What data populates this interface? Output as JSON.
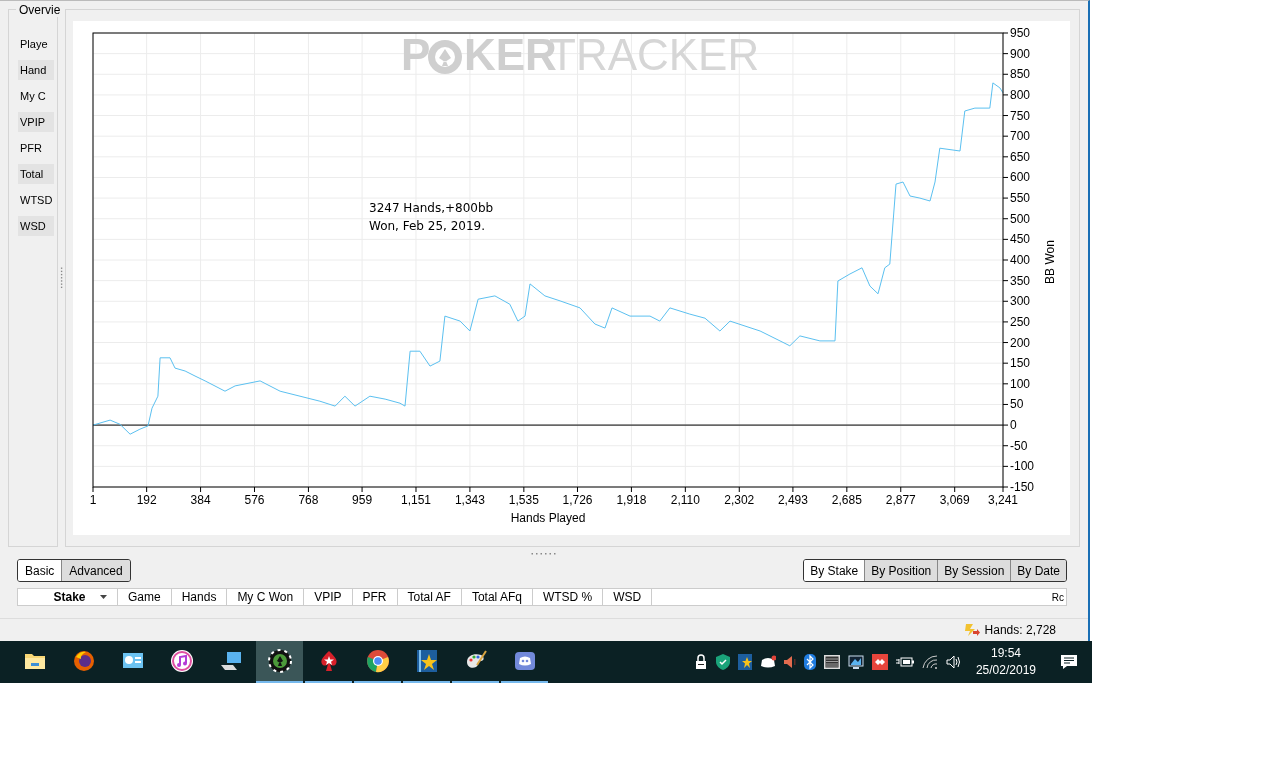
{
  "overview": {
    "title": "Overvie",
    "items": [
      {
        "label": "Playe"
      },
      {
        "label": "Hand"
      },
      {
        "label": "My C"
      },
      {
        "label": "VPIP"
      },
      {
        "label": "PFR"
      },
      {
        "label": "Total"
      },
      {
        "label": "WTSD"
      },
      {
        "label": "WSD"
      }
    ]
  },
  "chart": {
    "logo": [
      "P",
      "KER",
      "TRACKER"
    ],
    "chart_data": {
      "type": "line",
      "xlabel": "Hands Played",
      "ylabel": "BB Won",
      "xlim": [
        1,
        3241
      ],
      "ylim": [
        -150,
        950
      ],
      "xticks": [
        {
          "value": 1,
          "label": "1"
        },
        {
          "value": 192,
          "label": "192"
        },
        {
          "value": 384,
          "label": "384"
        },
        {
          "value": 576,
          "label": "576"
        },
        {
          "value": 768,
          "label": "768"
        },
        {
          "value": 959,
          "label": "959"
        },
        {
          "value": 1151,
          "label": "1,151"
        },
        {
          "value": 1343,
          "label": "1,343"
        },
        {
          "value": 1535,
          "label": "1,535"
        },
        {
          "value": 1726,
          "label": "1,726"
        },
        {
          "value": 1918,
          "label": "1,918"
        },
        {
          "value": 2110,
          "label": "2,110"
        },
        {
          "value": 2302,
          "label": "2,302"
        },
        {
          "value": 2493,
          "label": "2,493"
        },
        {
          "value": 2685,
          "label": "2,685"
        },
        {
          "value": 2877,
          "label": "2,877"
        },
        {
          "value": 3069,
          "label": "3,069"
        },
        {
          "value": 3241,
          "label": "3,241"
        }
      ],
      "yticks": [
        -150,
        -100,
        -50,
        0,
        50,
        100,
        150,
        200,
        250,
        300,
        350,
        400,
        450,
        500,
        550,
        600,
        650,
        700,
        750,
        800,
        850,
        900,
        950
      ],
      "x": [
        1,
        62,
        97,
        133,
        168,
        197,
        211,
        232,
        240,
        275,
        293,
        329,
        364,
        400,
        471,
        507,
        596,
        667,
        738,
        809,
        863,
        898,
        934,
        987,
        1041,
        1094,
        1112,
        1130,
        1165,
        1201,
        1236,
        1254,
        1308,
        1343,
        1372,
        1432,
        1485,
        1514,
        1539,
        1557,
        1610,
        1664,
        1735,
        1788,
        1824,
        1849,
        1913,
        1984,
        2019,
        2055,
        2126,
        2180,
        2233,
        2269,
        2376,
        2447,
        2482,
        2518,
        2589,
        2643,
        2653,
        2696,
        2739,
        2767,
        2796,
        2820,
        2838,
        2860,
        2885,
        2910,
        2945,
        2981,
        2999,
        3016,
        3088,
        3105,
        3141,
        3194,
        3205,
        3230,
        3241
      ],
      "series": [
        {
          "color": "#5bc0f0",
          "values": [
            0,
            12,
            2,
            -22,
            -10,
            -2,
            41,
            70,
            163,
            163,
            138,
            131,
            119,
            107,
            82,
            95,
            107,
            82,
            70,
            58,
            46,
            70,
            46,
            70,
            63,
            53,
            46,
            179,
            179,
            143,
            155,
            264,
            252,
            228,
            305,
            313,
            293,
            252,
            264,
            342,
            313,
            301,
            284,
            245,
            235,
            284,
            264,
            264,
            252,
            284,
            269,
            259,
            228,
            252,
            228,
            204,
            192,
            216,
            204,
            204,
            349,
            366,
            381,
            337,
            318,
            381,
            390,
            584,
            589,
            555,
            550,
            543,
            589,
            671,
            664,
            761,
            768,
            768,
            829,
            817,
            805
          ]
        }
      ],
      "grid": true,
      "annotations": [
        "3247 Hands,+800bb Won, Feb 25, 2019."
      ]
    }
  },
  "mode_tabs": [
    {
      "label": "Basic",
      "selected": true
    },
    {
      "label": "Advanced",
      "selected": false
    }
  ],
  "group_tabs": [
    {
      "label": "By Stake",
      "selected": true
    },
    {
      "label": "By Position",
      "selected": false
    },
    {
      "label": "By Session",
      "selected": false
    },
    {
      "label": "By Date",
      "selected": false
    }
  ],
  "table": {
    "columns": [
      {
        "label": "Stake",
        "sorted": true
      },
      {
        "label": "Game",
        "sorted": false
      },
      {
        "label": "Hands",
        "sorted": false
      },
      {
        "label": "My C Won",
        "sorted": false
      },
      {
        "label": "VPIP",
        "sorted": false
      },
      {
        "label": "PFR",
        "sorted": false
      },
      {
        "label": "Total AF",
        "sorted": false
      },
      {
        "label": "Total AFq",
        "sorted": false
      },
      {
        "label": "WTSD %",
        "sorted": false
      },
      {
        "label": "WSD",
        "sorted": false
      }
    ],
    "side_label": "Rc"
  },
  "status_bar": {
    "hands": "Hands: 2,728"
  },
  "taskbar": {
    "apps": [
      {
        "running": false,
        "selected": false
      },
      {
        "running": false,
        "selected": false
      },
      {
        "running": false,
        "selected": false
      },
      {
        "running": false,
        "selected": false
      },
      {
        "running": false,
        "selected": false
      },
      {
        "running": true,
        "selected": true
      },
      {
        "running": true,
        "selected": false
      },
      {
        "running": true,
        "selected": false
      },
      {
        "running": true,
        "selected": false
      },
      {
        "running": true,
        "selected": false
      },
      {
        "running": true,
        "selected": false
      }
    ],
    "time": "19:54",
    "date": "25/02/2019"
  }
}
